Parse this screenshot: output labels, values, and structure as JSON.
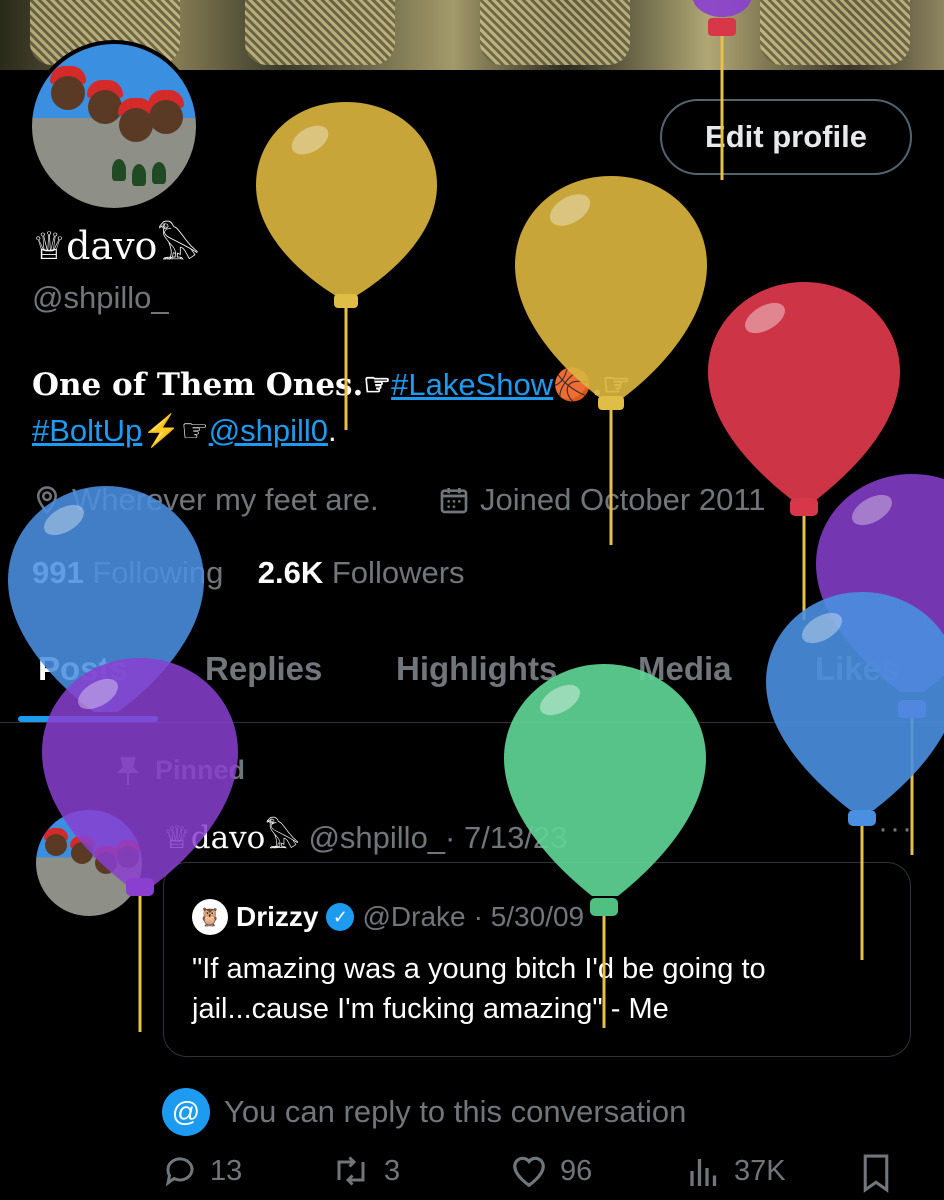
{
  "profile": {
    "edit_button": "Edit profile",
    "display_name": "♕davo𓅃",
    "handle": "@shpillo_",
    "bio": {
      "text1": "One of Them Ones.☞",
      "link1": "#LakeShow",
      "text2": "🏀.☞",
      "link2": "#BoltUp",
      "text3": "⚡☞",
      "link3": "@shpill0",
      "text4": "."
    },
    "location": "Wherever my feet are.",
    "joined": "Joined October 2011",
    "following_count": "991",
    "following_label": "Following",
    "followers_count": "2.6K",
    "followers_label": "Followers"
  },
  "tabs": [
    {
      "label": "Posts"
    },
    {
      "label": "Replies"
    },
    {
      "label": "Highlights"
    },
    {
      "label": "Media"
    },
    {
      "label": "Likes"
    }
  ],
  "post": {
    "pinned_label": "Pinned",
    "author_name": "♕davo𓅃",
    "author_handle": "@shpillo_",
    "date": "· 7/13/23",
    "more": "···",
    "quote": {
      "name": "Drizzy",
      "handle": "@Drake",
      "date": "· 5/30/09",
      "text": "\"If amazing was a young bitch I'd be going to jail...cause I'm fucking amazing\"  - Me"
    },
    "reply_note": "You can reply to this conversation",
    "actions": {
      "replies": "13",
      "reposts": "3",
      "likes": "96",
      "views": "37K"
    }
  },
  "colors": {
    "accent": "#1d9bf0",
    "muted": "#71767b",
    "balloon_gold": "#d9b33e",
    "balloon_red": "#d8374a",
    "balloon_purple": "#8a3fd0",
    "balloon_blue": "#4a8fe0",
    "balloon_green": "#5fd494"
  }
}
